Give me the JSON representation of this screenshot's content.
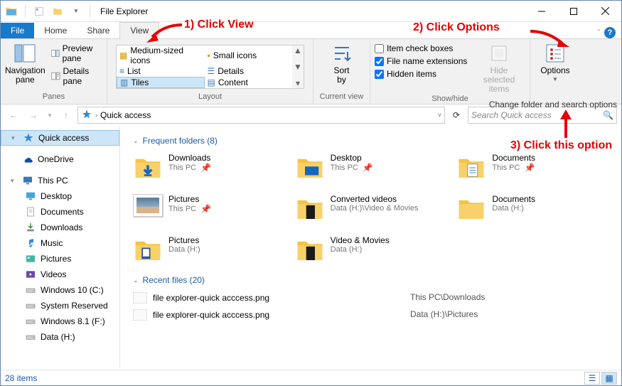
{
  "title": "File Explorer",
  "tabs": {
    "file": "File",
    "home": "Home",
    "share": "Share",
    "view": "View"
  },
  "ribbon": {
    "panes": {
      "nav": "Navigation\npane",
      "preview": "Preview pane",
      "details": "Details pane",
      "group": "Panes"
    },
    "layout": {
      "items": [
        "Medium-sized icons",
        "Small icons",
        "List",
        "Details",
        "Tiles",
        "Content"
      ],
      "selected": "Tiles",
      "group": "Layout"
    },
    "currentview": {
      "sortby": "Sort\nby",
      "group": "Current view"
    },
    "showhide": {
      "checkboxes": "Item check boxes",
      "ext": "File name extensions",
      "hidden": "Hidden items",
      "hidebtn": "Hide selected\nitems",
      "group": "Show/hide"
    },
    "options": "Options",
    "subtext": "Change folder and search options"
  },
  "address": {
    "location": "Quick access",
    "search_ph": "Search Quick access"
  },
  "sidebar": {
    "quick": "Quick access",
    "onedrive": "OneDrive",
    "thispc": "This PC",
    "items": [
      "Desktop",
      "Documents",
      "Downloads",
      "Music",
      "Pictures",
      "Videos",
      "Windows 10 (C:)",
      "System Reserved",
      "Windows 8.1 (F:)",
      "Data (H:)"
    ]
  },
  "content": {
    "freq_head": "Frequent folders (8)",
    "tiles": [
      {
        "name": "Downloads",
        "loc": "This PC",
        "pin": true,
        "icon": "downloads"
      },
      {
        "name": "Desktop",
        "loc": "This PC",
        "pin": true,
        "icon": "desktop"
      },
      {
        "name": "Documents",
        "loc": "This PC",
        "pin": true,
        "icon": "documents"
      },
      {
        "name": "Pictures",
        "loc": "This PC",
        "pin": true,
        "icon": "pictures"
      },
      {
        "name": "Converted videos",
        "loc": "Data (H:)\\Video & Movies",
        "pin": false,
        "icon": "folderdark"
      },
      {
        "name": "Documents",
        "loc": "Data (H:)",
        "pin": false,
        "icon": "folder"
      },
      {
        "name": "Pictures",
        "loc": "Data (H:)",
        "pin": false,
        "icon": "picturesalt"
      },
      {
        "name": "Video & Movies",
        "loc": "Data (H:)",
        "pin": false,
        "icon": "folderdark"
      }
    ],
    "recent_head": "Recent files (20)",
    "recent": [
      {
        "name": "file explorer-quick acccess.png",
        "loc": "This PC\\Downloads"
      },
      {
        "name": "file explorer-quick acccess.png",
        "loc": "Data (H:)\\Pictures"
      }
    ]
  },
  "status": "28 items",
  "annotations": {
    "a1": "1) Click View",
    "a2": "2) Click Options",
    "a3": "3) Click this option"
  }
}
